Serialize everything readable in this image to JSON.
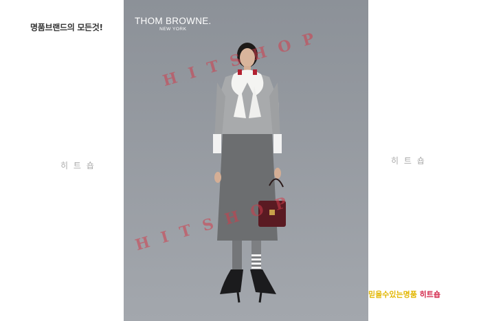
{
  "tagline": "명품브랜드의 모든것!",
  "watermark_left": "히 트 숍",
  "watermark_right": "히 트 숍",
  "brand": {
    "name": "THOM BROWNE.",
    "sub": "NEW YORK"
  },
  "photo_watermark": "HITSHOP",
  "bottom_caption": {
    "part1": "믿을수있는명품 ",
    "part2": "히트숍"
  },
  "colors": {
    "background": "#ffffff",
    "photo_bg": "#8e939a",
    "watermark_red": "#d23c4b",
    "caption_yellow": "#e2b600",
    "caption_red": "#d3264a"
  }
}
